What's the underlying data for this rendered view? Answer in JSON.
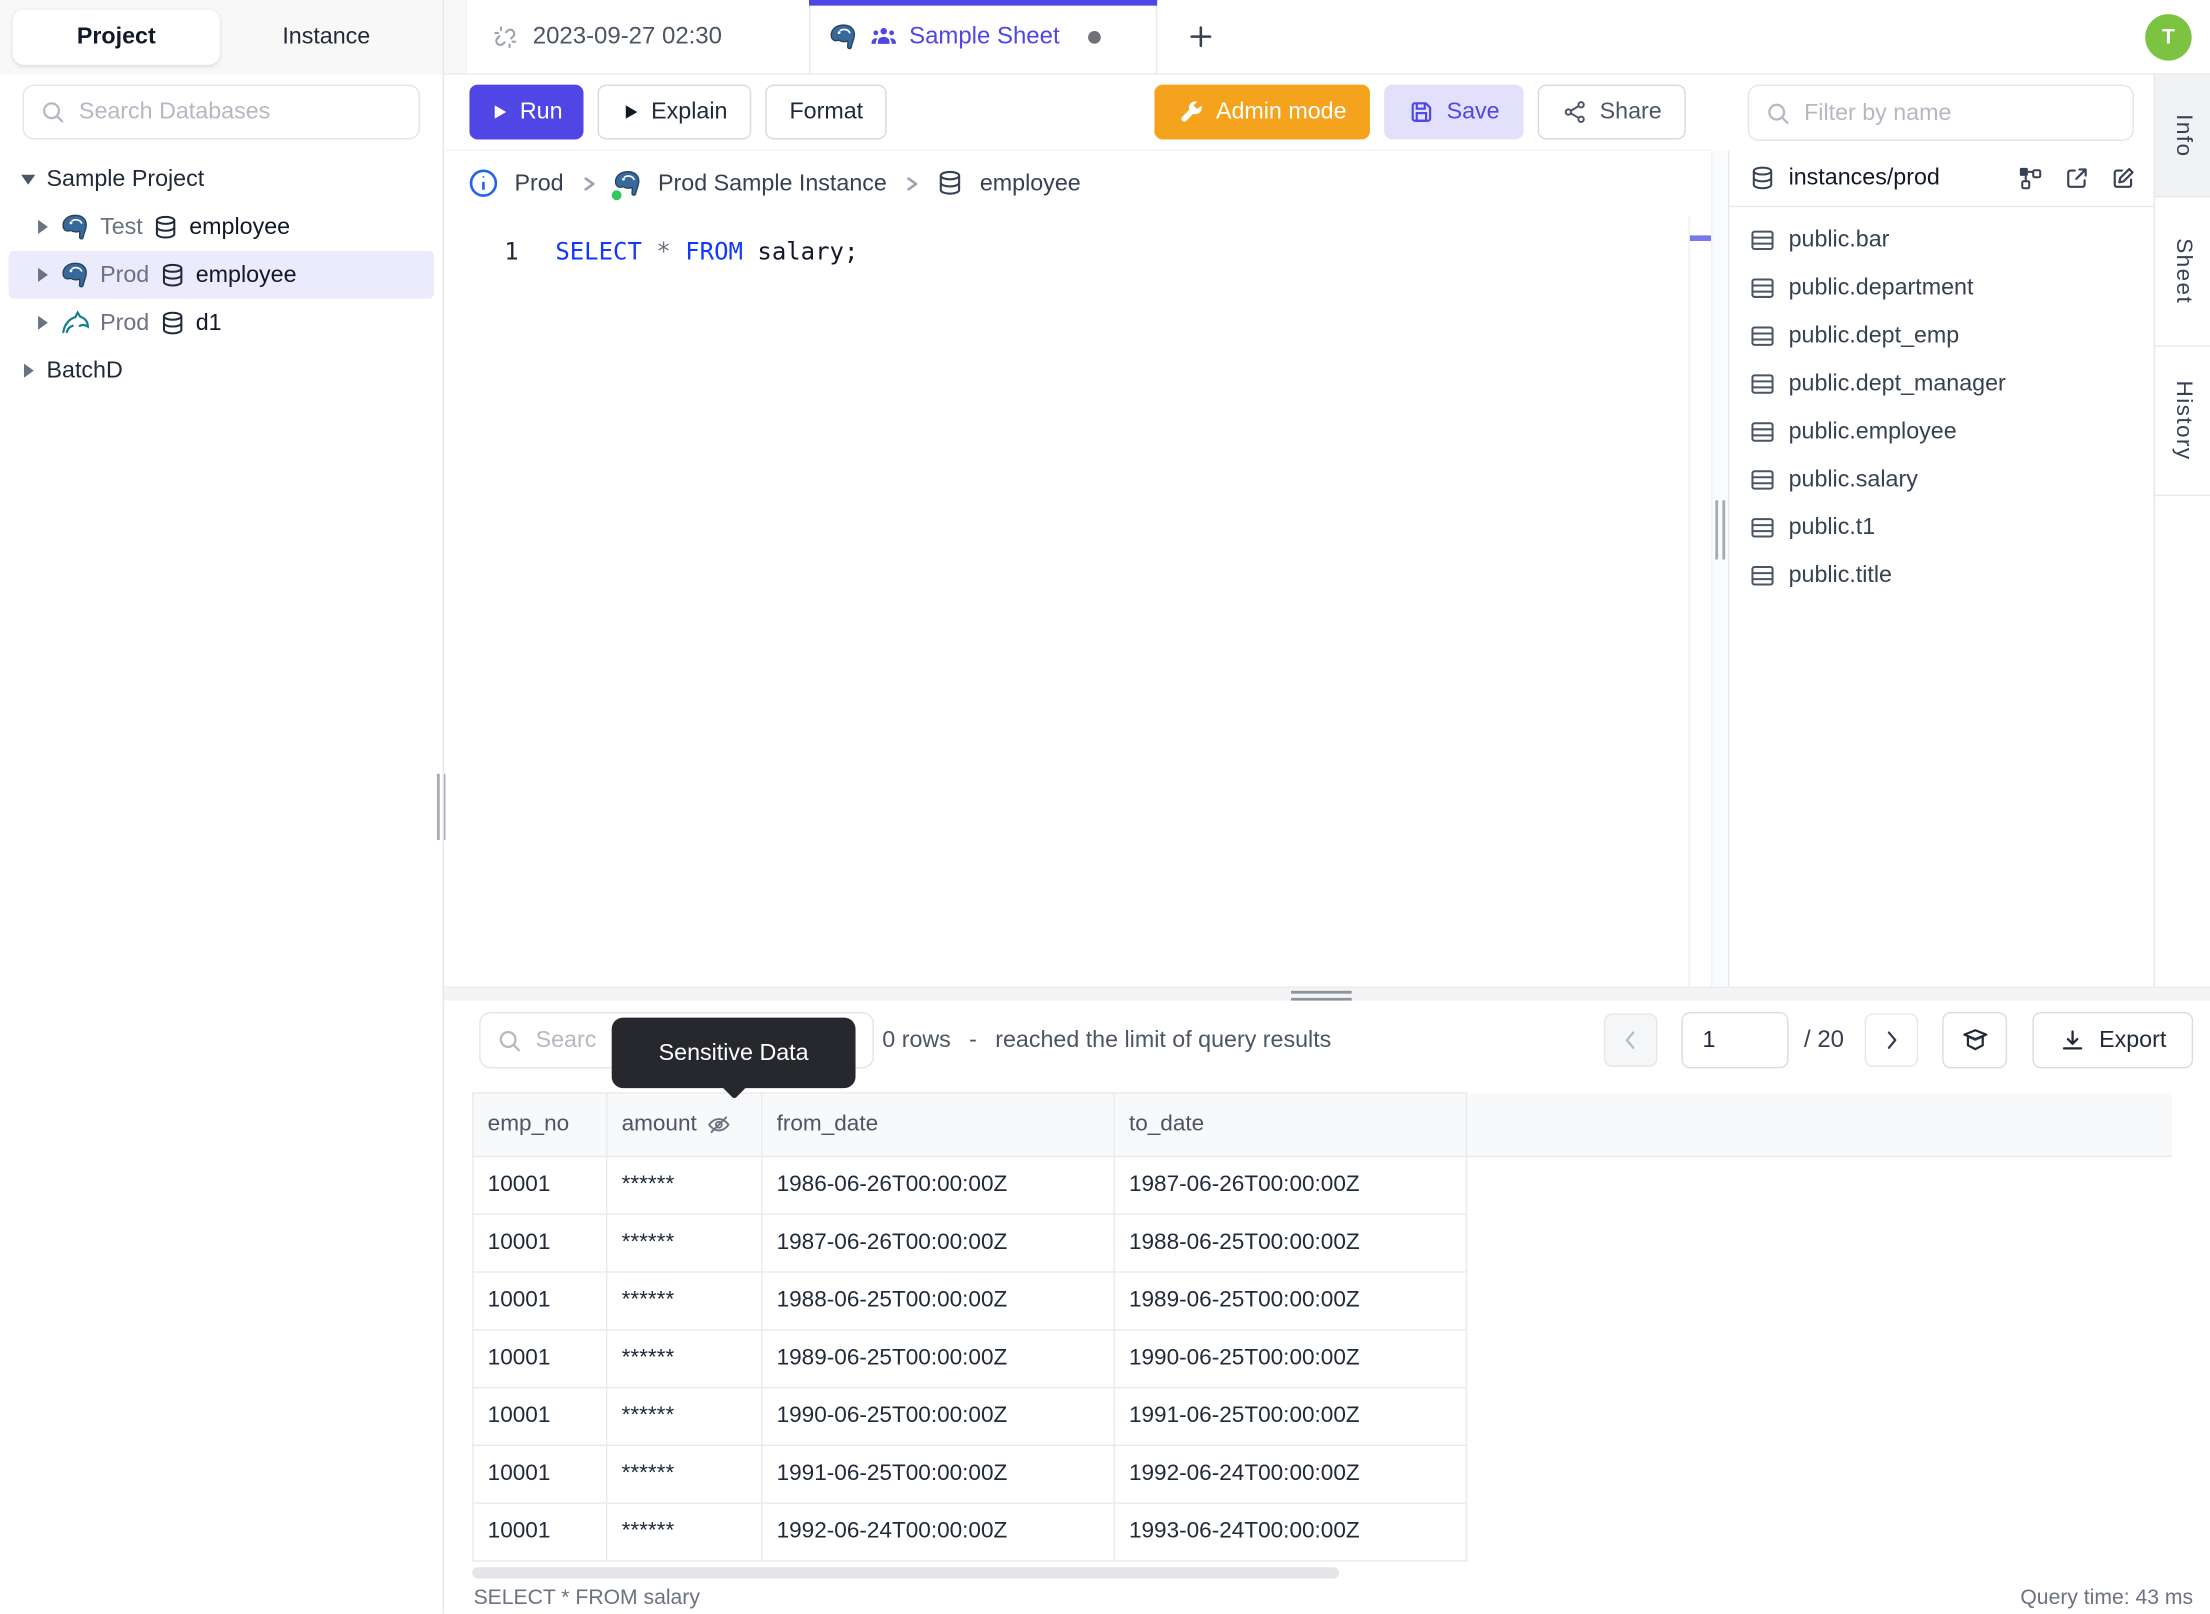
{
  "colors": {
    "accent_indigo": "#4f46e5",
    "admin_orange": "#f5a31c",
    "save_bg": "#e3e0fb",
    "avatar_green": "#7cc342",
    "selected_tree_row": "#ecebfb",
    "tooltip_bg": "#26282d",
    "sql_keyword_blue": "#1038ff",
    "status_dot_green": "#34c759"
  },
  "icons": {
    "search-icon": "magnifier circle+handle",
    "unlink-icon": "broken chain link",
    "people-icon": "three-person group",
    "plus-icon": "plus cross",
    "play-icon": "filled right triangle",
    "wrench-icon": "wrench",
    "save-icon": "floppy disk",
    "share-icon": "three nodes network",
    "info-icon": "circled i",
    "chevron-right-icon": "angle bracket",
    "database-icon": "cylinder stack",
    "table-icon": "grid rows rect",
    "postgres-icon": "elephant head",
    "mysql-icon": "dolphin swoosh",
    "schema-diagram-icon": "connected squares",
    "external-link-icon": "box with outgoing arrow",
    "edit-icon": "pencil on square",
    "eye-off-icon": "eye with slash",
    "cube-icon": "mortarboard box",
    "download-icon": "arrow into tray"
  },
  "sidebar": {
    "tabs": [
      {
        "label": "Project"
      },
      {
        "label": "Instance"
      }
    ],
    "search_placeholder": "Search Databases",
    "tree": {
      "root_expanded": "Sample Project",
      "items": [
        {
          "env": "Test",
          "db": "employee"
        },
        {
          "env": "Prod",
          "db": "employee"
        },
        {
          "env": "Prod",
          "db": "d1"
        }
      ],
      "root_collapsed": "BatchD"
    }
  },
  "tabbar": {
    "history_tab_label": "2023-09-27 02:30",
    "sheet_tab_label": "Sample Sheet",
    "avatar_initial": "T"
  },
  "toolbar": {
    "run_label": "Run",
    "explain_label": "Explain",
    "format_label": "Format",
    "admin_mode_label": "Admin mode",
    "save_label": "Save",
    "share_label": "Share"
  },
  "breadcrumb": {
    "environment": "Prod",
    "instance": "Prod Sample Instance",
    "database": "employee"
  },
  "editor": {
    "line_number": "1",
    "keyword_select": "SELECT",
    "operator_star": "*",
    "keyword_from": "FROM",
    "tail": "salary;"
  },
  "right_panel": {
    "filter_placeholder": "Filter by name",
    "header_label": "instances/prod",
    "tables": [
      "public.bar",
      "public.department",
      "public.dept_emp",
      "public.dept_manager",
      "public.employee",
      "public.salary",
      "public.t1",
      "public.title"
    ]
  },
  "rail": {
    "tabs": [
      "Info",
      "Sheet",
      "History"
    ]
  },
  "results": {
    "search_placeholder_visible": "Searc",
    "tooltip_text": "Sensitive Data",
    "rows_count": "0 rows",
    "dash": "-",
    "limit_note": "reached the limit of query results",
    "page_value": "1",
    "page_total": "/ 20",
    "export_label": "Export",
    "table": {
      "columns": [
        "emp_no",
        "amount",
        "from_date",
        "to_date"
      ],
      "rows": [
        [
          "10001",
          "******",
          "1986-06-26T00:00:00Z",
          "1987-06-26T00:00:00Z"
        ],
        [
          "10001",
          "******",
          "1987-06-26T00:00:00Z",
          "1988-06-25T00:00:00Z"
        ],
        [
          "10001",
          "******",
          "1988-06-25T00:00:00Z",
          "1989-06-25T00:00:00Z"
        ],
        [
          "10001",
          "******",
          "1989-06-25T00:00:00Z",
          "1990-06-25T00:00:00Z"
        ],
        [
          "10001",
          "******",
          "1990-06-25T00:00:00Z",
          "1991-06-25T00:00:00Z"
        ],
        [
          "10001",
          "******",
          "1991-06-25T00:00:00Z",
          "1992-06-24T00:00:00Z"
        ],
        [
          "10001",
          "******",
          "1992-06-24T00:00:00Z",
          "1993-06-24T00:00:00Z"
        ]
      ]
    },
    "status_query": "SELECT * FROM salary",
    "status_time": "Query time: 43 ms"
  }
}
